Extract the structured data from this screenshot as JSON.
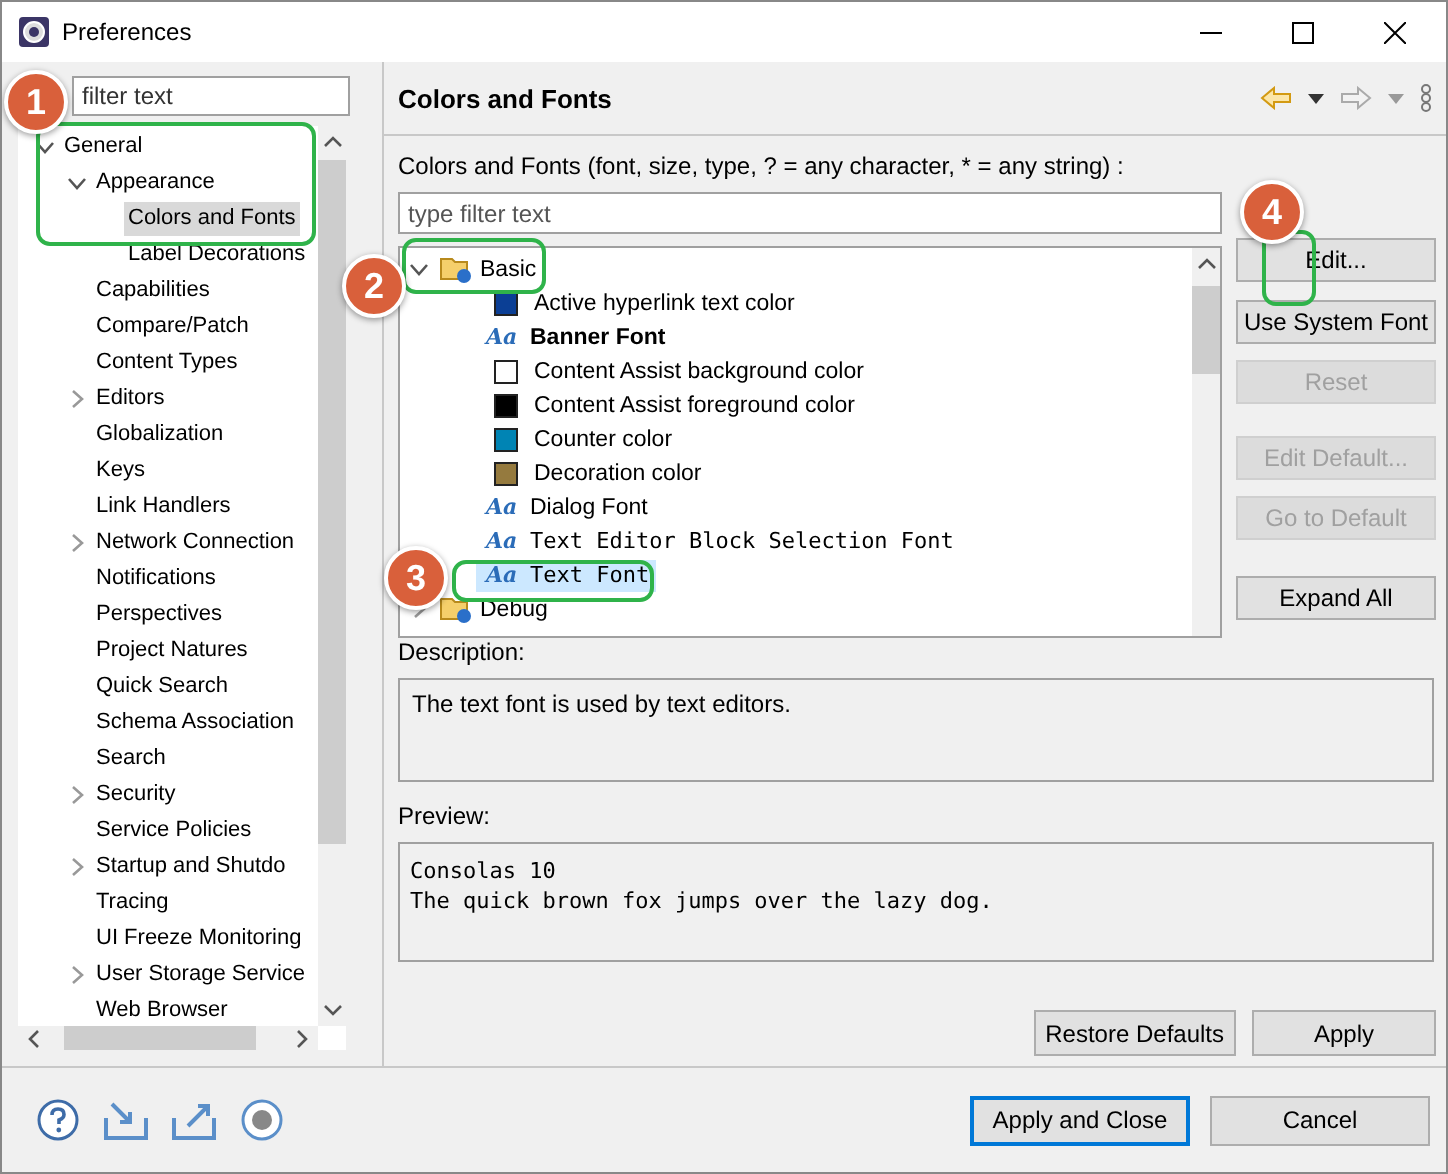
{
  "window": {
    "title": "Preferences"
  },
  "sidebar": {
    "filter": {
      "placeholder": "filter text"
    },
    "items": [
      {
        "label": "General",
        "expanded": true,
        "selected": false,
        "children": [
          {
            "label": "Appearance",
            "expanded": true,
            "selected": false,
            "children": [
              {
                "label": "Colors and Fonts",
                "selected": true
              },
              {
                "label": "Label Decorations",
                "selected": false
              }
            ]
          },
          {
            "label": "Capabilities",
            "selected": false
          },
          {
            "label": "Compare/Patch",
            "selected": false
          },
          {
            "label": "Content Types",
            "selected": false
          },
          {
            "label": "Editors",
            "expanded": false,
            "selected": false
          },
          {
            "label": "Globalization",
            "selected": false
          },
          {
            "label": "Keys",
            "selected": false
          },
          {
            "label": "Link Handlers",
            "selected": false
          },
          {
            "label": "Network Connection",
            "expanded": false,
            "selected": false
          },
          {
            "label": "Notifications",
            "selected": false
          },
          {
            "label": "Perspectives",
            "selected": false
          },
          {
            "label": "Project Natures",
            "selected": false
          },
          {
            "label": "Quick Search",
            "selected": false
          },
          {
            "label": "Schema Association",
            "selected": false
          },
          {
            "label": "Search",
            "selected": false
          },
          {
            "label": "Security",
            "expanded": false,
            "selected": false
          },
          {
            "label": "Service Policies",
            "selected": false
          },
          {
            "label": "Startup and Shutdo",
            "expanded": false,
            "selected": false
          },
          {
            "label": "Tracing",
            "selected": false
          },
          {
            "label": "UI Freeze Monitoring",
            "selected": false
          },
          {
            "label": "User Storage Service",
            "expanded": false,
            "selected": false
          },
          {
            "label": "Web Browser",
            "selected": false
          }
        ]
      }
    ]
  },
  "page": {
    "title": "Colors and Fonts",
    "filter_label": "Colors and Fonts (font, size, type, ? = any character, * = any string) :",
    "filter": {
      "placeholder": "type filter text"
    },
    "tree": [
      {
        "label": "Basic",
        "kind": "category",
        "expanded": true,
        "selected": false,
        "children": [
          {
            "label": "Active hyperlink text color",
            "kind": "color",
            "color": "#0b3f95",
            "selected": false
          },
          {
            "label": "Banner Font",
            "kind": "font",
            "icon_text": "Aa",
            "bold": true,
            "mono": false,
            "selected": false
          },
          {
            "label": "Content Assist background color",
            "kind": "color",
            "color": "#ffffff",
            "selected": false
          },
          {
            "label": "Content Assist foreground color",
            "kind": "color",
            "color": "#000000",
            "selected": false
          },
          {
            "label": "Counter color",
            "kind": "color",
            "color": "#0084b4",
            "selected": false
          },
          {
            "label": "Decoration color",
            "kind": "color",
            "color": "#957a3e",
            "selected": false
          },
          {
            "label": "Dialog Font",
            "kind": "font",
            "icon_text": "Aa",
            "bold": false,
            "mono": false,
            "selected": false
          },
          {
            "label": "Text Editor Block Selection Font",
            "kind": "font",
            "icon_text": "Aa",
            "bold": false,
            "mono": true,
            "selected": false
          },
          {
            "label": "Text Font",
            "kind": "font",
            "icon_text": "Aa",
            "bold": false,
            "mono": true,
            "selected": true
          }
        ]
      },
      {
        "label": "Debug",
        "kind": "category",
        "expanded": false,
        "selected": false
      }
    ],
    "buttons": [
      {
        "label": "Edit...",
        "disabled": false
      },
      {
        "label": "Use System Font",
        "disabled": false
      },
      {
        "label": "Reset",
        "disabled": true
      },
      {
        "label": "Edit Default...",
        "disabled": true
      },
      {
        "label": "Go to Default",
        "disabled": true
      },
      {
        "label": "Expand All",
        "disabled": false
      }
    ],
    "description_label": "Description:",
    "description": "The text font is used by text editors.",
    "preview_label": "Preview:",
    "preview": [
      "Consolas 10",
      "The quick brown fox jumps over the lazy dog."
    ],
    "actions": [
      "Restore Defaults",
      "Apply"
    ]
  },
  "footer": {
    "buttons": [
      {
        "label": "Apply and Close",
        "default": true
      },
      {
        "label": "Cancel",
        "default": false
      }
    ]
  },
  "callouts": [
    {
      "number": "1"
    },
    {
      "number": "2"
    },
    {
      "number": "3"
    },
    {
      "number": "4"
    }
  ]
}
